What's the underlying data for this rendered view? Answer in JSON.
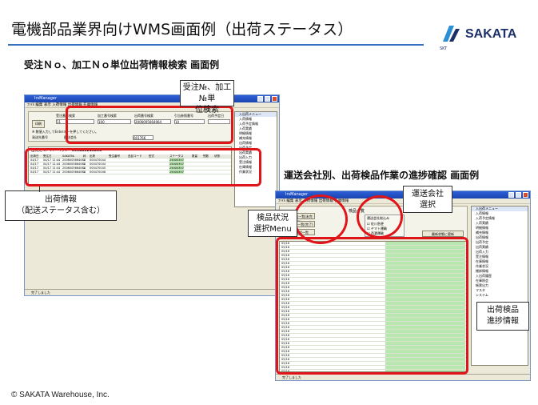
{
  "slide": {
    "title": "電機部品業界向けWMS画面例（出荷ステータス）",
    "section1": "受注Ｎｏ、加工Ｎｏ単位出荷情報検索 画面例",
    "section2": "運送会社別、出荷検品作業の進捗確認 画面例",
    "copyright": "© SAKATA Warehouse, Inc."
  },
  "logo": {
    "name": "SAKATA",
    "sub": "SKT"
  },
  "callouts": {
    "search_line1": "受注№、加工№単",
    "search_line2": "位検索",
    "ship_line1": "出荷情報",
    "ship_line2": "（配送ステータス含む）",
    "menu_line1": "検品状況",
    "menu_line2": "選択Menu",
    "carrier_line1": "運送会社",
    "carrier_line2": "選択",
    "progress_line1": "出荷検品",
    "progress_line2": "進捗情報"
  },
  "window1": {
    "title": "IrsManager",
    "menu": "ﾌｧｲﾙ  編集  表示  入荷情報  出荷情報  在庫情報",
    "field_labels": [
      "受注番号検索",
      "加工番号検索",
      "出荷番号検索",
      "引当参照番号",
      "出荷予定日"
    ],
    "field_values": [
      "11",
      "100",
      "2006005664064",
      "10"
    ],
    "print_label": "印刷",
    "note": "※ 数値入力してEnterキーを押してください。",
    "row_labels": [
      "発送先番号",
      "配送会社",
      "出荷日"
    ],
    "detail_value": "001766",
    "ship_header_label": "出荷先  スーパーベラン",
    "ship_header_no": "500463210253",
    "grid_headers": [
      "出荷日",
      "受注日",
      "SAKAT№",
      "枠",
      "出荷",
      "受注番号",
      "品目コード",
      "型式",
      "ステータス",
      "数量",
      "残数",
      "状態"
    ],
    "rows": [
      [
        "04/17",
        "04/17 11:44",
        "2006005664064",
        "1",
        "000470044",
        "",
        "",
        "",
        "25005357"
      ],
      [
        "04/17",
        "04/17 11:44",
        "2006005664064",
        "1",
        "000470044",
        "",
        "",
        "",
        "25005357"
      ],
      [
        "04/17",
        "04/17 11:44",
        "2006005664064",
        "1",
        "000470045",
        "",
        "",
        "",
        "25005357"
      ],
      [
        "04/17",
        "04/17 11:44",
        "2006005664064",
        "1",
        "000470046",
        "",
        "",
        "",
        "25005357"
      ]
    ],
    "side_header": "入出荷メニュー",
    "side_items": [
      "入荷情報",
      "入荷予定情報",
      "入荷実績",
      "明細情報",
      "補充情報",
      "出荷情報",
      "出荷予定",
      "出荷実績",
      "出荷入力",
      "受注情報",
      "在庫情報",
      "作業状況"
    ],
    "status": "完了しました"
  },
  "window2": {
    "title": "IrsManager",
    "menu": "ﾌｧｲﾙ  編集  表示  入荷情報  出荷情報  在庫情報",
    "menu_items": [
      "出荷検品一覧(未完了)",
      "出荷検品一覧(完了)",
      "出荷確認一覧"
    ],
    "panel_title": "検品一覧",
    "carrier_group_label": "運送会社絞込み",
    "carriers": [
      "佐川急便",
      "ヤマト運輸",
      "西濃運輸"
    ],
    "refresh_button": "最新状態に更新",
    "rows_col1": [
      "05/16",
      "05/16",
      "05/16",
      "05/16",
      "05/16",
      "05/16",
      "05/16",
      "05/16",
      "05/16",
      "05/16",
      "05/16",
      "05/16",
      "05/16",
      "05/16",
      "05/16",
      "05/16",
      "05/16",
      "05/16",
      "05/16",
      "05/16",
      "05/16",
      "05/16",
      "05/16",
      "05/16",
      "05/16",
      "05/16",
      "05/16",
      "05/16",
      "05/16",
      "05/16",
      "05/16",
      "05/16",
      "05/16"
    ],
    "side_header": "入出荷メニュー",
    "side_items": [
      "入荷情報",
      "入荷予定情報",
      "入荷実績",
      "明細情報",
      "補充情報",
      "出荷情報",
      "出荷予定",
      "出荷実績",
      "出荷入力",
      "受注情報",
      "在庫情報",
      "作業状況",
      "棚卸情報",
      "入出荷履歴",
      "在庫照会",
      "帳票出力",
      "マスタ",
      "システム"
    ],
    "status": "完了しました"
  }
}
